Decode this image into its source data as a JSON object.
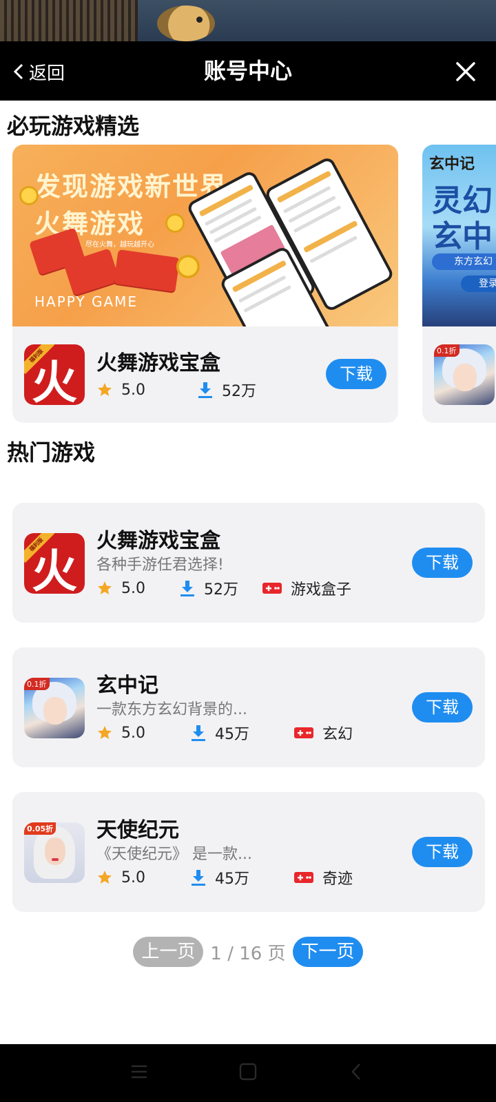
{
  "header": {
    "back_label": "返回",
    "title": "账号中心"
  },
  "featured": {
    "section_title": "必玩游戏精选",
    "main": {
      "banner_line1": "发现游戏新世界",
      "banner_line2": "火舞游戏",
      "banner_sub": "海量精品游戏，尽在火舞，越玩越开心",
      "banner_en": "HAPPY GAME",
      "name": "火舞游戏宝盒",
      "rating": "5.0",
      "downloads": "52万",
      "download_label": "下载",
      "icon_glyph": "火",
      "icon_ribbon": "福利版"
    },
    "peek": {
      "banner_brand": "玄中记",
      "banner_big": "灵幻玄中",
      "banner_sub": "东方玄幻",
      "banner_login": "登录",
      "icon_tag": "0.1折"
    }
  },
  "hot": {
    "section_title": "热门游戏",
    "games": [
      {
        "name": "火舞游戏宝盒",
        "desc": "各种手游任君选择!",
        "rating": "5.0",
        "downloads": "52万",
        "tag": "游戏盒子",
        "download_label": "下载",
        "icon_glyph": "火",
        "icon_ribbon": "福利版"
      },
      {
        "name": "玄中记",
        "desc": "一款东方玄幻背景的...",
        "rating": "5.0",
        "downloads": "45万",
        "tag": "玄幻",
        "download_label": "下载",
        "icon_tag": "0.1折"
      },
      {
        "name": "天使纪元",
        "desc": "《天使纪元》 是一款...",
        "rating": "5.0",
        "downloads": "45万",
        "tag": "奇迹",
        "download_label": "下载",
        "icon_tag": "0.05折"
      }
    ]
  },
  "pagination": {
    "prev_label": "上一页",
    "info": "1 / 16 页",
    "next_label": "下一页"
  },
  "icons": {
    "back": "chevron-left-icon",
    "close": "close-icon",
    "rating": "star-icon",
    "downloads": "download-icon",
    "tag": "gamepad-icon"
  },
  "colors": {
    "accent": "#1f8df0",
    "star": "#f5a623",
    "tag_red": "#e8262b",
    "disabled": "#b3b3b3",
    "header_bg": "#000000",
    "card_bg": "#f2f2f4"
  }
}
